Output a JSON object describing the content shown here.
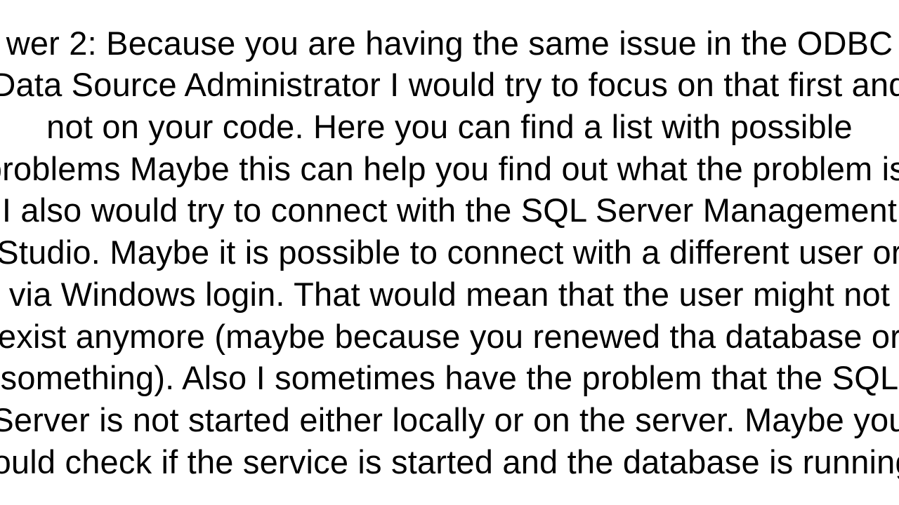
{
  "answer": {
    "label_prefix": "wer 2: ",
    "body": "Because you are having the same issue in the ODBC Data Source Administrator I would try to focus on that first and not on your code. Here you can find a list with possible problems Maybe this can help you find out what the problem is. I also would try to connect with the SQL Server Management Studio. Maybe it is possible to connect with a different user or via Windows login.  That would mean that the user might not exist anymore (maybe because you renewed tha database or something). Also I sometimes have the problem that the SQL Server is not started either locally or on the server. Maybe you could check if the service is started and the database is running."
  }
}
